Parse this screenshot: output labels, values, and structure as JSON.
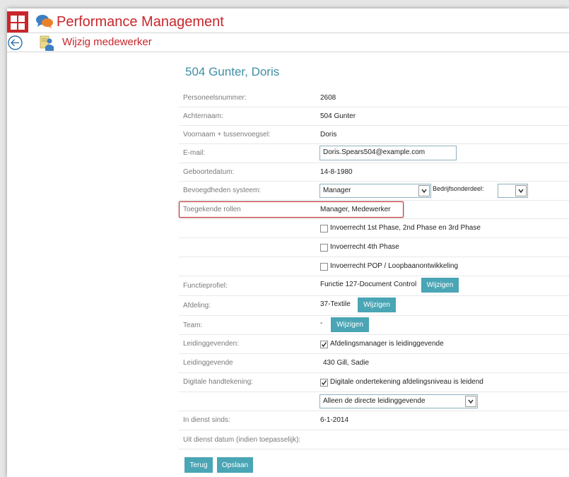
{
  "app": {
    "title": "Performance Management"
  },
  "subheader": {
    "title": "Wijzig medewerker"
  },
  "employee": {
    "title": "504 Gunter, Doris"
  },
  "fields": {
    "personeelsnummer": {
      "label": "Personeelsnummer:",
      "value": "2608"
    },
    "achternaam": {
      "label": "Achternaam:",
      "value": "504 Gunter"
    },
    "voornaam": {
      "label": "Voornaam + tussenvoegsel:",
      "value": "Doris"
    },
    "email": {
      "label": "E-mail:",
      "value": "Doris.Spears504@example.com"
    },
    "geboortedatum": {
      "label": "Geboortedatum:",
      "value": "14-8-1980"
    },
    "bevoegdheden": {
      "label": "Bevoegdheden systeem:",
      "value": "Manager",
      "bedrijf_label": "Bedrijfsonderdeel:",
      "bedrijf_value": ""
    },
    "rollen": {
      "label": "Toegekende rollen",
      "value": "Manager, Medewerker"
    },
    "invoer1": {
      "label": "Invoerrecht 1st Phase, 2nd Phase en 3rd Phase",
      "checked": false
    },
    "invoer4": {
      "label": "Invoerrecht 4th Phase",
      "checked": false
    },
    "invoerpop": {
      "label": "Invoerrecht POP / Loopbaanontwikkeling",
      "checked": false
    },
    "functieprofiel": {
      "label": "Functieprofiel:",
      "value": "Functie 127-Document Control",
      "button": "Wijzigen"
    },
    "afdeling": {
      "label": "Afdeling:",
      "value": "37-Textile",
      "button": "Wijzigen"
    },
    "team": {
      "label": "Team:",
      "value": "-",
      "button": "Wijzigen"
    },
    "leidinggevenden": {
      "label": "Leidinggevenden:",
      "check_label": "Afdelingsmanager is leidinggevende",
      "checked": true
    },
    "leidinggevende": {
      "label": "Leidinggevende",
      "value": "430 Gill, Sadie"
    },
    "handtekening": {
      "label": "Digitale handtekening:",
      "check_label": "Digitale ondertekening afdelingsniveau is leidend",
      "checked": true,
      "select_value": "Alleen de directe leidinggevende"
    },
    "in_dienst": {
      "label": "In dienst sinds:",
      "value": "6-1-2014"
    },
    "uit_dienst": {
      "label": "Uit dienst datum (indien toepasselijk):",
      "value": ""
    }
  },
  "buttons": {
    "terug": "Terug",
    "opslaan": "Opslaan"
  },
  "icons": {
    "app": "app-grid-icon",
    "chat": "chat-bubbles-icon",
    "back": "back-arrow-icon",
    "person": "person-document-icon",
    "check": "checkmark-icon",
    "dropdown": "chevron-down-icon"
  },
  "colors": {
    "brand_red": "#c9262b",
    "accent_teal": "#4aa5b5",
    "title_teal": "#3f8fa5",
    "highlight_border": "#c9262b"
  }
}
